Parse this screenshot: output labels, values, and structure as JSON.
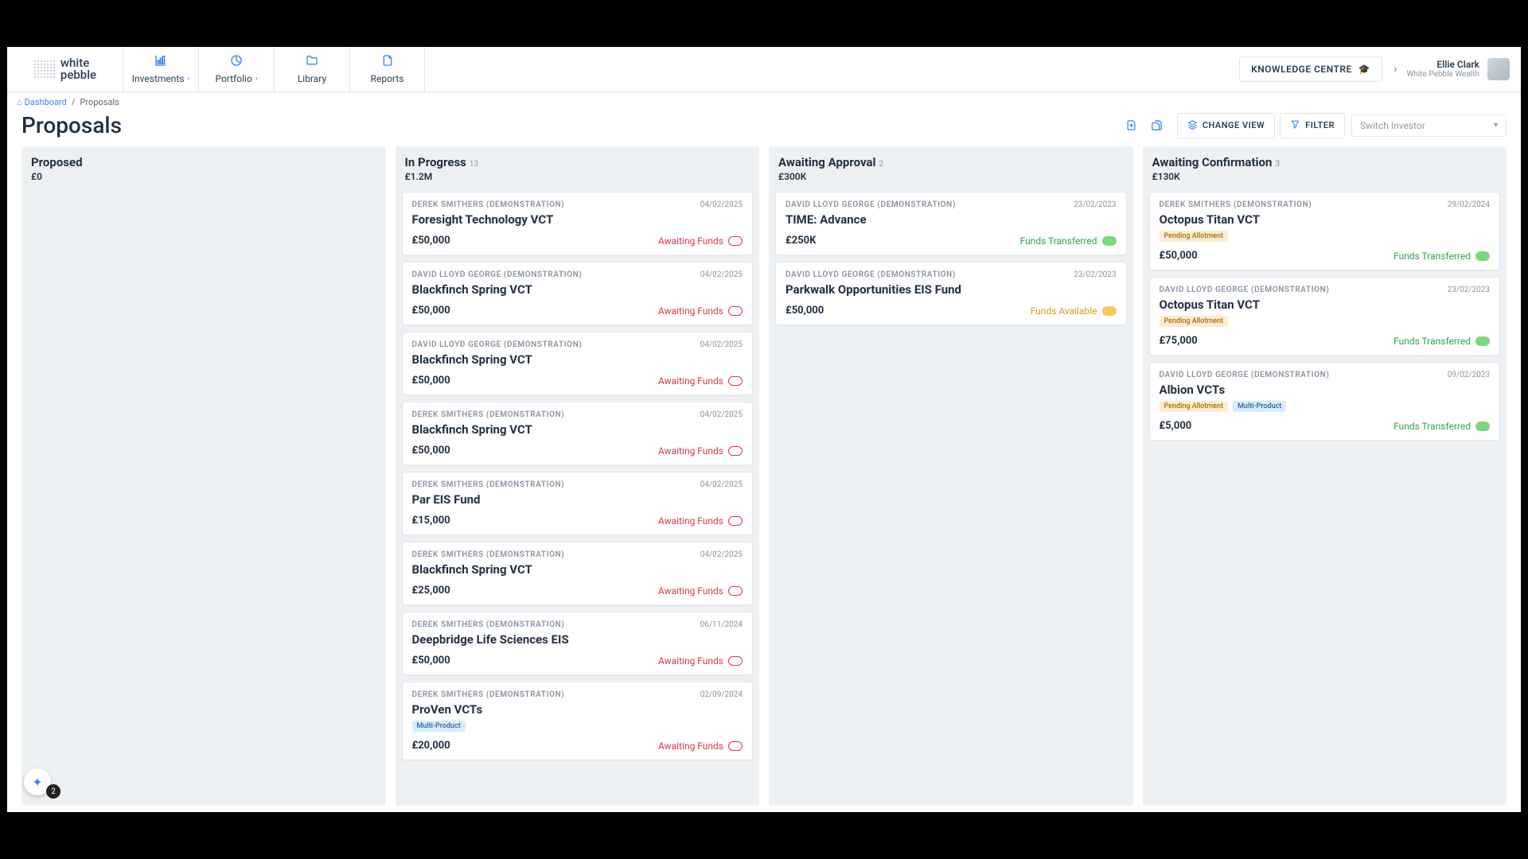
{
  "brand": {
    "name": "white",
    "sub": "pebble"
  },
  "nav": {
    "investments": "Investments",
    "portfolio": "Portfolio",
    "library": "Library",
    "reports": "Reports"
  },
  "knowledge_centre": "KNOWLEDGE CENTRE",
  "user": {
    "name": "Ellie Clark",
    "org": "White Pebble Wealth"
  },
  "breadcrumb": {
    "home": "Dashboard",
    "current": "Proposals"
  },
  "page_title": "Proposals",
  "toolbar": {
    "change_view": "CHANGE VIEW",
    "filter": "FILTER",
    "switch_investor_placeholder": "Switch Investor"
  },
  "tags": {
    "pending_allotment": "Pending Allotment",
    "multi_product": "Multi-Product"
  },
  "corner_badge": "2",
  "columns": [
    {
      "title": "Proposed",
      "count": "",
      "sum": "£0",
      "cards": []
    },
    {
      "title": "In Progress",
      "count": "13",
      "sum": "£1.2M",
      "cards": [
        {
          "client": "DEREK SMITHERS (DEMONSTRATION)",
          "date": "04/02/2025",
          "title": "Foresight Technology VCT",
          "amount": "£50,000",
          "status": "Awaiting Funds",
          "status_color": "red",
          "tags": []
        },
        {
          "client": "DAVID LLOYD GEORGE (DEMONSTRATION)",
          "date": "04/02/2025",
          "title": "Blackfinch Spring VCT",
          "amount": "£50,000",
          "status": "Awaiting Funds",
          "status_color": "red",
          "tags": []
        },
        {
          "client": "DAVID LLOYD GEORGE (DEMONSTRATION)",
          "date": "04/02/2025",
          "title": "Blackfinch Spring VCT",
          "amount": "£50,000",
          "status": "Awaiting Funds",
          "status_color": "red",
          "tags": []
        },
        {
          "client": "DEREK SMITHERS (DEMONSTRATION)",
          "date": "04/02/2025",
          "title": "Blackfinch Spring VCT",
          "amount": "£50,000",
          "status": "Awaiting Funds",
          "status_color": "red",
          "tags": []
        },
        {
          "client": "DEREK SMITHERS (DEMONSTRATION)",
          "date": "04/02/2025",
          "title": "Par EIS Fund",
          "amount": "£15,000",
          "status": "Awaiting Funds",
          "status_color": "red",
          "tags": []
        },
        {
          "client": "DEREK SMITHERS (DEMONSTRATION)",
          "date": "04/02/2025",
          "title": "Blackfinch Spring VCT",
          "amount": "£25,000",
          "status": "Awaiting Funds",
          "status_color": "red",
          "tags": []
        },
        {
          "client": "DEREK SMITHERS (DEMONSTRATION)",
          "date": "06/11/2024",
          "title": "Deepbridge Life Sciences EIS",
          "amount": "£50,000",
          "status": "Awaiting Funds",
          "status_color": "red",
          "tags": []
        },
        {
          "client": "DEREK SMITHERS (DEMONSTRATION)",
          "date": "02/09/2024",
          "title": "ProVen VCTs",
          "amount": "£20,000",
          "status": "Awaiting Funds",
          "status_color": "red",
          "tags": [
            "multi_product"
          ]
        }
      ]
    },
    {
      "title": "Awaiting Approval",
      "count": "2",
      "sum": "£300K",
      "cards": [
        {
          "client": "DAVID LLOYD GEORGE (DEMONSTRATION)",
          "date": "23/02/2023",
          "title": "TIME: Advance",
          "amount": "£250K",
          "status": "Funds Transferred",
          "status_color": "green",
          "tags": []
        },
        {
          "client": "DAVID LLOYD GEORGE (DEMONSTRATION)",
          "date": "23/02/2023",
          "title": "Parkwalk Opportunities EIS Fund",
          "amount": "£50,000",
          "status": "Funds Available",
          "status_color": "amber",
          "tags": []
        }
      ]
    },
    {
      "title": "Awaiting Confirmation",
      "count": "3",
      "sum": "£130K",
      "cards": [
        {
          "client": "DEREK SMITHERS (DEMONSTRATION)",
          "date": "29/02/2024",
          "title": "Octopus Titan VCT",
          "amount": "£50,000",
          "status": "Funds Transferred",
          "status_color": "green",
          "tags": [
            "pending_allotment"
          ]
        },
        {
          "client": "DAVID LLOYD GEORGE (DEMONSTRATION)",
          "date": "23/02/2023",
          "title": "Octopus Titan VCT",
          "amount": "£75,000",
          "status": "Funds Transferred",
          "status_color": "green",
          "tags": [
            "pending_allotment"
          ]
        },
        {
          "client": "DAVID LLOYD GEORGE (DEMONSTRATION)",
          "date": "09/02/2023",
          "title": "Albion VCTs",
          "amount": "£5,000",
          "status": "Funds Transferred",
          "status_color": "green",
          "tags": [
            "pending_allotment",
            "multi_product"
          ]
        }
      ]
    }
  ]
}
